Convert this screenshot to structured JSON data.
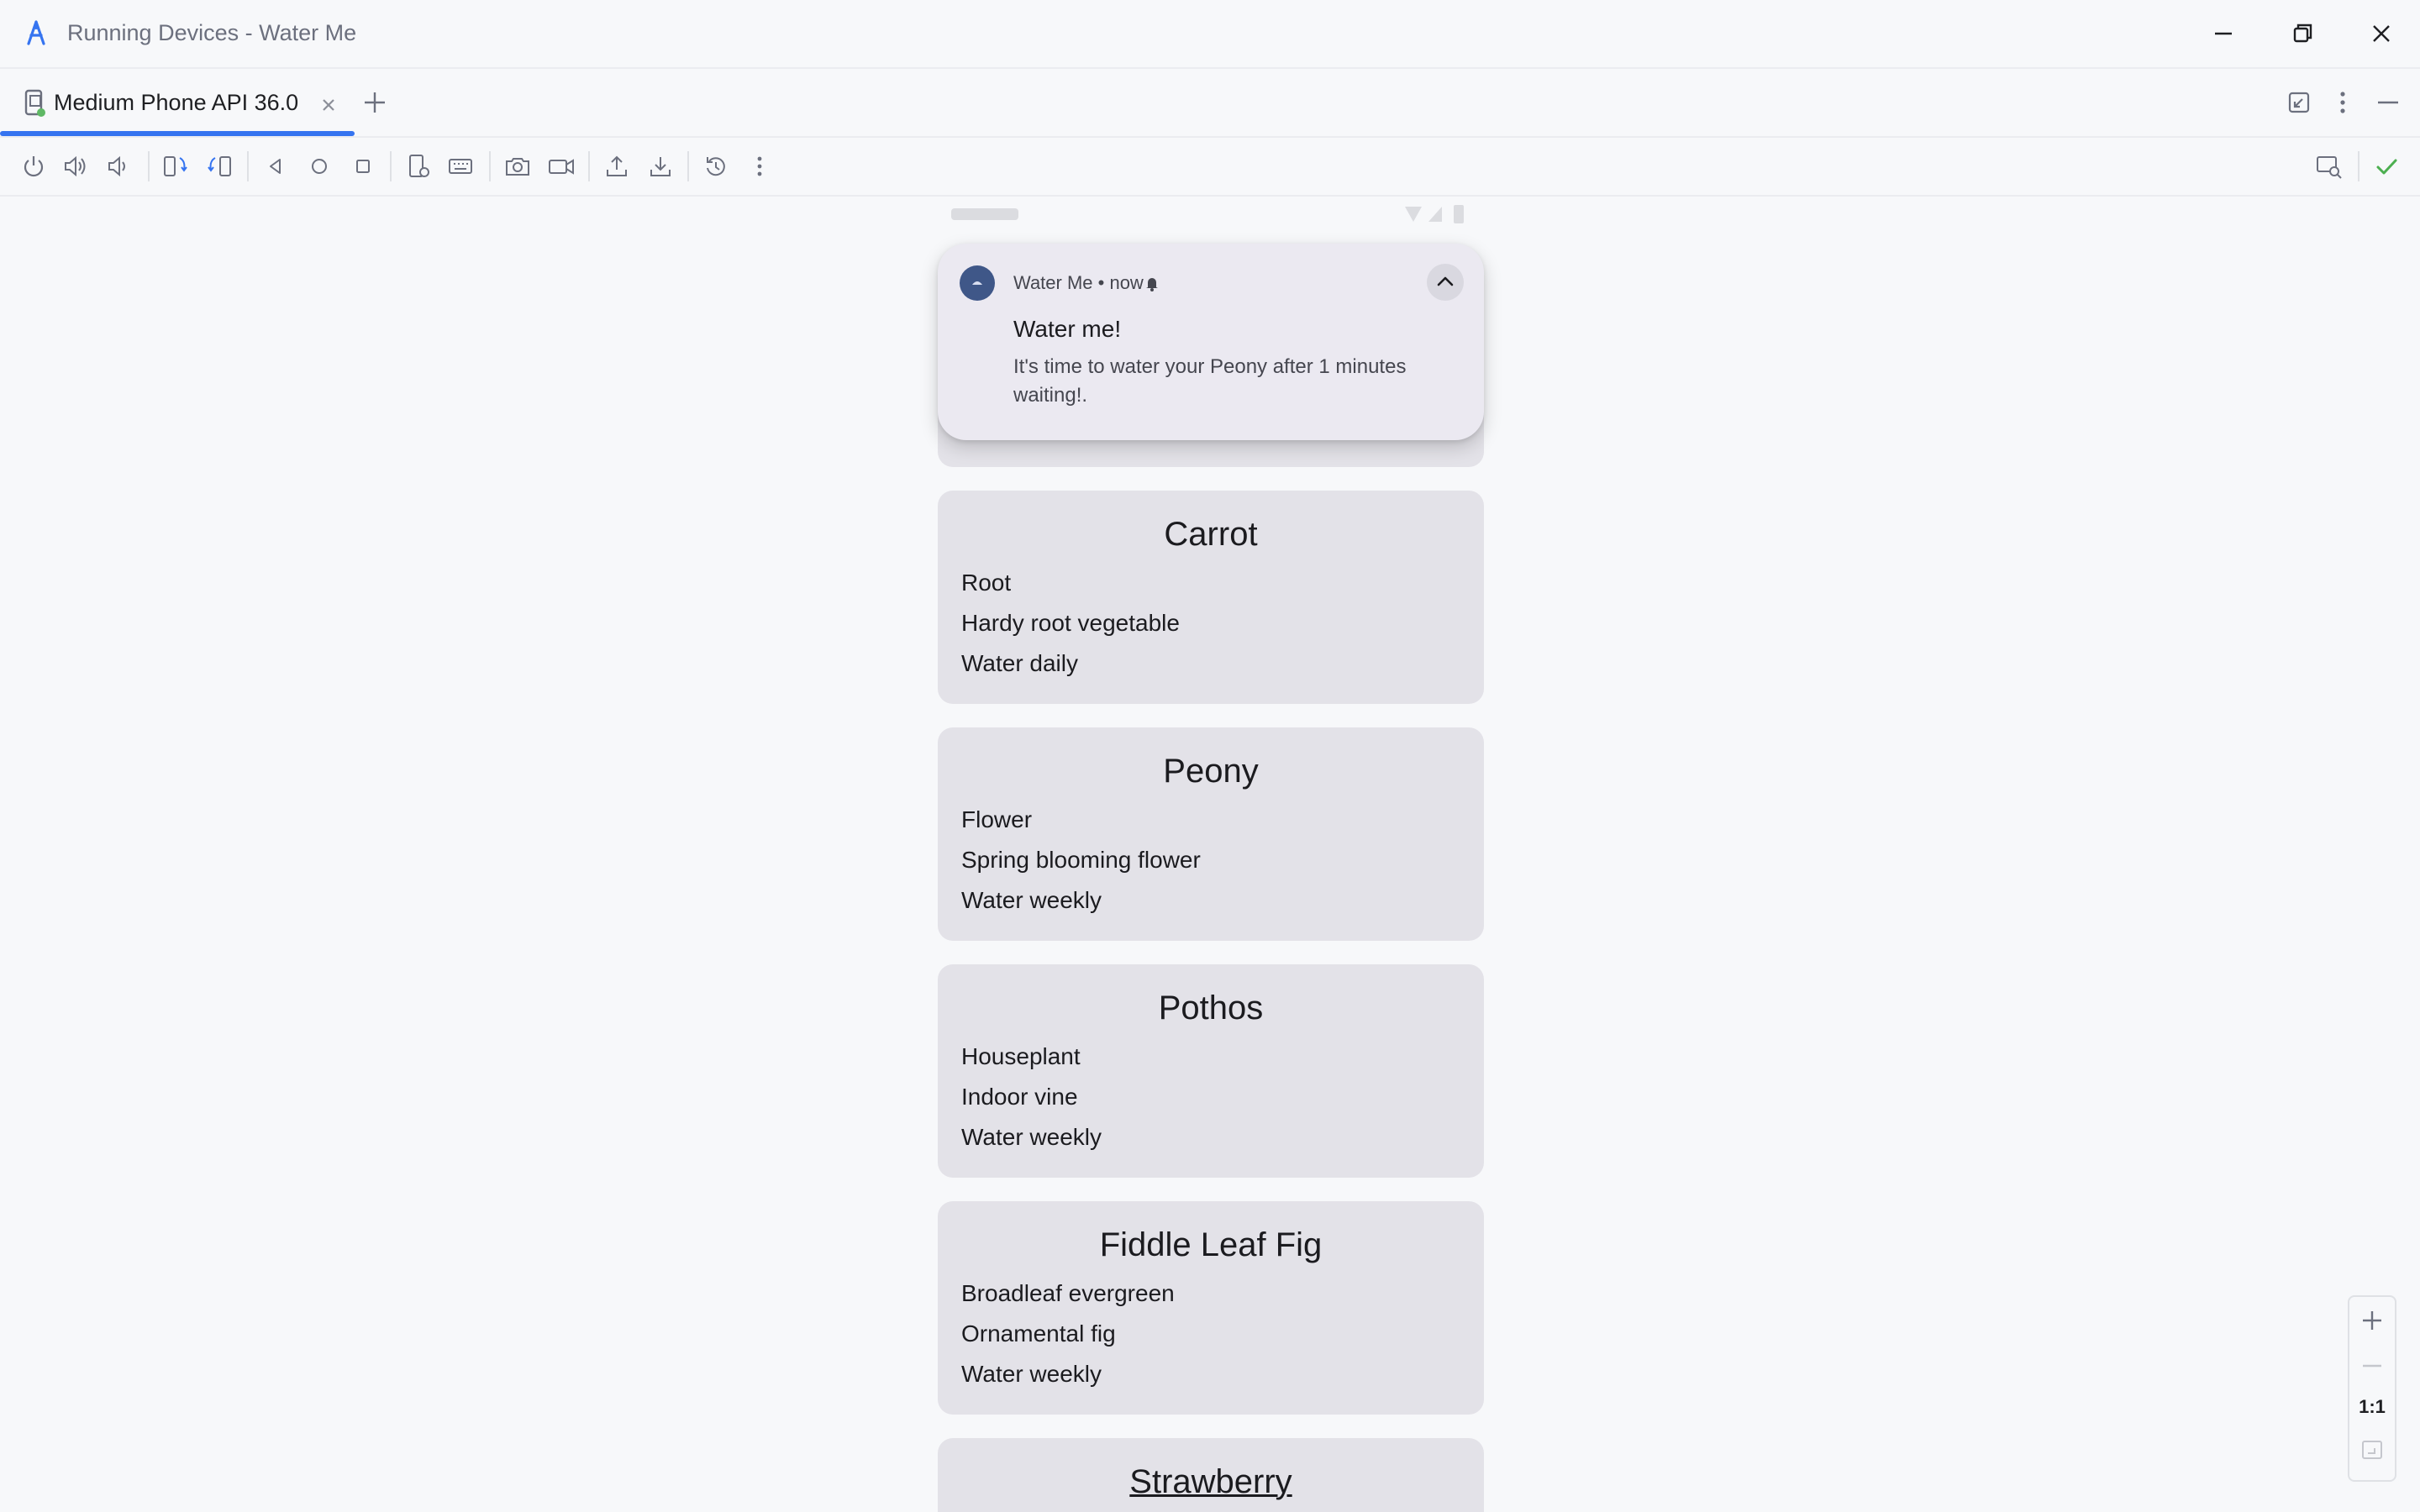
{
  "window": {
    "title": "Running Devices - Water Me",
    "icons": [
      "android-studio-logo",
      "minimize-icon",
      "restore-icon",
      "close-icon"
    ]
  },
  "tabs": {
    "active_label": "Medium Phone API 36.0",
    "active_color": "#3574f0",
    "icons": [
      "device-tab-icon",
      "tab-close-icon",
      "add-tab-icon",
      "restore-layout-icon",
      "more-options-icon",
      "hide-panel-icon"
    ]
  },
  "toolbar": {
    "icons": [
      "power-icon",
      "volume-up-icon",
      "volume-down-icon",
      "rotate-left-icon",
      "rotate-right-icon",
      "back-icon",
      "home-icon",
      "overview-icon",
      "device-settings-icon",
      "keyboard-icon",
      "screenshot-icon",
      "screen-record-icon",
      "upload-icon",
      "download-icon",
      "reset-icon",
      "more-icon",
      "device-explorer-icon",
      "success-check-icon"
    ]
  },
  "notification": {
    "header": "Water Me • now",
    "title": "Water me!",
    "text": "It's time to water your Peony after 1 minutes waiting!.",
    "icons": [
      "app-icon",
      "bell-icon",
      "expand-less-icon"
    ]
  },
  "plants": [
    {
      "name": "Carrot",
      "type": "Root",
      "description": "Hardy root vegetable",
      "schedule": "Water daily"
    },
    {
      "name": "Peony",
      "type": "Flower",
      "description": "Spring blooming flower",
      "schedule": "Water weekly"
    },
    {
      "name": "Pothos",
      "type": "Houseplant",
      "description": "Indoor vine",
      "schedule": "Water weekly"
    },
    {
      "name": "Fiddle Leaf Fig",
      "type": "Broadleaf evergreen",
      "description": "Ornamental fig",
      "schedule": "Water weekly"
    },
    {
      "name": "Strawberry"
    }
  ],
  "zoom": {
    "actual_size_label": "1:1",
    "icons": [
      "zoom-in-icon",
      "zoom-out-icon",
      "fit-screen-icon"
    ]
  },
  "colors": {
    "card_bg": "#e3e2e8",
    "notification_bg": "#ebe9f1",
    "success": "#4caf50"
  }
}
